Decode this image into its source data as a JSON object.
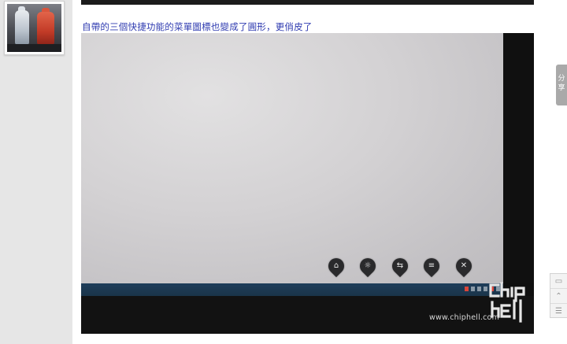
{
  "post": {
    "caption": "自帶的三個快捷功能的菜單圖標也變成了圓形，更俏皮了"
  },
  "photo": {
    "osd_icons": [
      "input-icon",
      "brightness-icon",
      "source-icon",
      "menu-icon",
      "close-icon"
    ],
    "osd_glyphs": [
      "⌂",
      "☼",
      "⇆",
      "≡",
      "✕"
    ],
    "watermark_text": "www.chiphell.com",
    "watermark_logo": "chip hell"
  },
  "sidebar_right": {
    "share_label": "分享",
    "tools": [
      "comment-icon",
      "up-icon",
      "list-icon"
    ],
    "tool_glyphs": [
      "▭",
      "⌃",
      "☰"
    ]
  },
  "colors": {
    "caption_link": "#2f3bb0",
    "left_column_bg": "#e6e6e6",
    "share_tab_bg": "#a9a9a9"
  }
}
